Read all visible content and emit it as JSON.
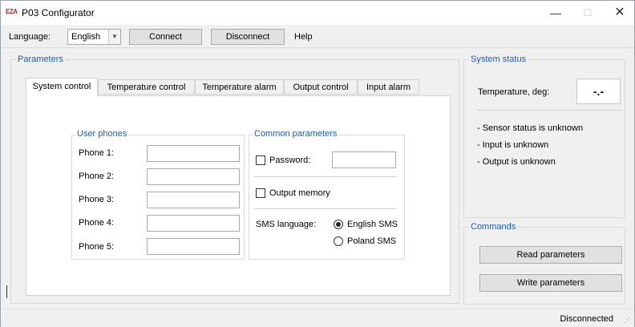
{
  "window": {
    "logo_text": "EZA",
    "title": "P03 Configurator",
    "minimize_glyph": "—",
    "maximize_glyph": "☐",
    "close_glyph": "✕"
  },
  "menubar": {
    "language_label": "Language:",
    "language_value": "English",
    "dropdown_glyph": "▼",
    "connect_label": "Connect",
    "disconnect_label": "Disconnect",
    "help_label": "Help"
  },
  "parameters": {
    "title": "Parameters",
    "tabs": [
      {
        "label": "System control",
        "active": true
      },
      {
        "label": "Temperature control",
        "active": false
      },
      {
        "label": "Temperature alarm",
        "active": false
      },
      {
        "label": "Output control",
        "active": false
      },
      {
        "label": "Input alarm",
        "active": false
      }
    ],
    "user_phones": {
      "title": "User phones",
      "phones": [
        {
          "label": "Phone 1:",
          "value": ""
        },
        {
          "label": "Phone 2:",
          "value": ""
        },
        {
          "label": "Phone 3:",
          "value": ""
        },
        {
          "label": "Phone 4:",
          "value": ""
        },
        {
          "label": "Phone 5:",
          "value": ""
        }
      ]
    },
    "common": {
      "title": "Common parameters",
      "password_label": "Password:",
      "password_value": "",
      "password_checked": false,
      "output_memory_label": "Output memory",
      "output_memory_checked": false,
      "sms_language_label": "SMS language:",
      "sms_options": [
        {
          "label": "English SMS",
          "selected": true
        },
        {
          "label": "Poland SMS",
          "selected": false
        }
      ]
    }
  },
  "system_status": {
    "title": "System status",
    "temperature_label": "Temperature, deg:",
    "temperature_value": "-.-",
    "messages": [
      "- Sensor status is unknown",
      "- Input is unknown",
      "- Output is unknown"
    ]
  },
  "commands": {
    "title": "Commands",
    "read_label": "Read parameters",
    "write_label": "Write parameters"
  },
  "statusbar": {
    "status": "Disconnected",
    "grip_glyph": "⋰"
  },
  "colors": {
    "group_title": "#1b5fb0",
    "logo": "#b5262a",
    "window_bg": "#f0f0f0"
  }
}
